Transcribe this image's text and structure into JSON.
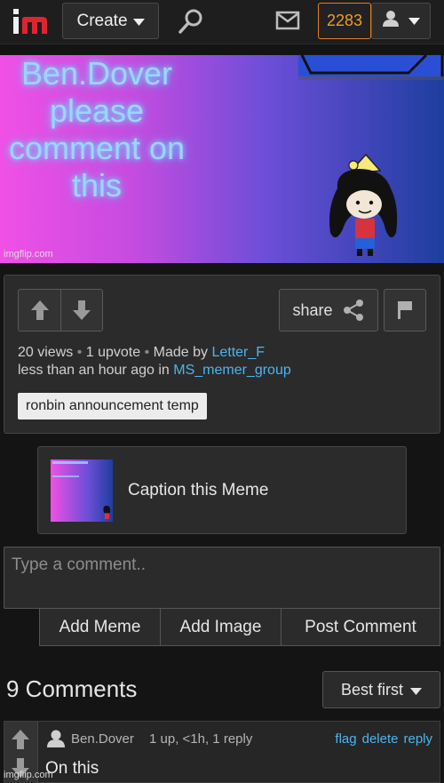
{
  "nav": {
    "create_label": "Create",
    "points": "2283"
  },
  "meme": {
    "overlay_text": "Ben.Dover please comment on this",
    "watermark": "imgflip.com"
  },
  "post": {
    "views": "20 views",
    "upvotes": "1 upvote",
    "made_by_prefix": "Made by",
    "author": "Letter_F",
    "time_prefix": "less than an hour ago in",
    "stream": "MS_memer_group",
    "share_label": "share",
    "tag": "ronbin announcement temp"
  },
  "caption": {
    "label": "Caption this Meme"
  },
  "comment_form": {
    "placeholder": "Type a comment..",
    "add_meme": "Add Meme",
    "add_image": "Add Image",
    "post_comment": "Post Comment"
  },
  "comments": {
    "title": "9 Comments",
    "sort_label": "Best first",
    "items": [
      {
        "user": "Ben.Dover",
        "meta": "1 up, <1h, 1 reply",
        "actions": [
          "flag",
          "delete",
          "reply"
        ],
        "text": "On this"
      }
    ]
  },
  "footer": {
    "watermark": "imgflip.com"
  },
  "colors": {
    "background": "#141414",
    "link": "#4bb5f0",
    "points_accent": "#e37d20"
  }
}
